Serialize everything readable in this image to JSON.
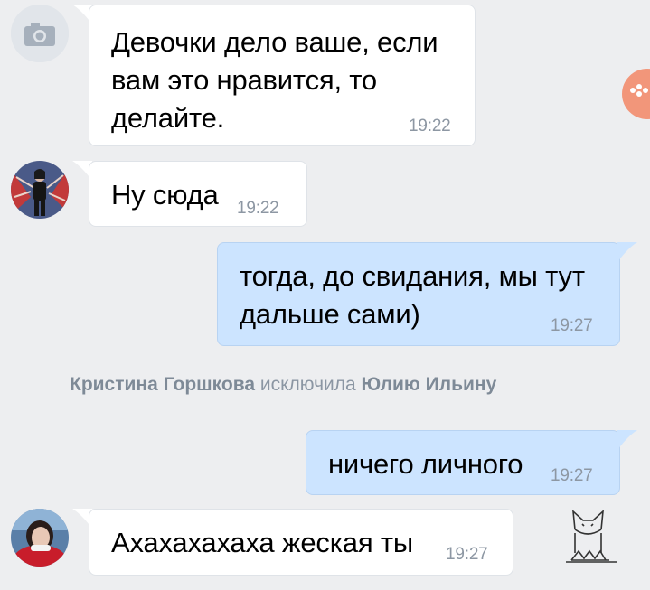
{
  "messages": [
    {
      "direction": "incoming",
      "text": "Девочки дело ваше, если вам это нравится, то делайте.",
      "lines": [
        "Девочки дело ваше, если",
        "вам это нравится, то",
        "делайте."
      ],
      "time": "19:22",
      "avatar": "camera-icon"
    },
    {
      "direction": "incoming",
      "text": "Ну сюда",
      "lines": [
        "Ну сюда"
      ],
      "time": "19:22",
      "avatar": "user-avatar"
    },
    {
      "direction": "outgoing",
      "text": "тогда, до свидания, мы тут дальше сами)",
      "lines": [
        "тогда, до свидания, мы тут",
        "дальше сами)"
      ],
      "time": "19:27"
    },
    {
      "direction": "outgoing",
      "text": "ничего личного",
      "lines": [
        "ничего личного"
      ],
      "time": "19:27"
    },
    {
      "direction": "incoming",
      "text": "Ахахахахаха жеская ты",
      "lines": [
        "Ахахахахаха жеская ты"
      ],
      "time": "19:27",
      "avatar": "user-avatar"
    }
  ],
  "system_event": {
    "actor": "Кристина Горшкова",
    "action": "исключила",
    "target": "Юлию Ильину"
  },
  "colors": {
    "background": "#edeef0",
    "incoming_bubble": "#ffffff",
    "outgoing_bubble": "#cce4ff",
    "time": "#8d97a3",
    "accent_button": "#f2967a"
  },
  "icons": [
    "camera-icon",
    "gamepad-icon",
    "cat-sticker-icon"
  ]
}
